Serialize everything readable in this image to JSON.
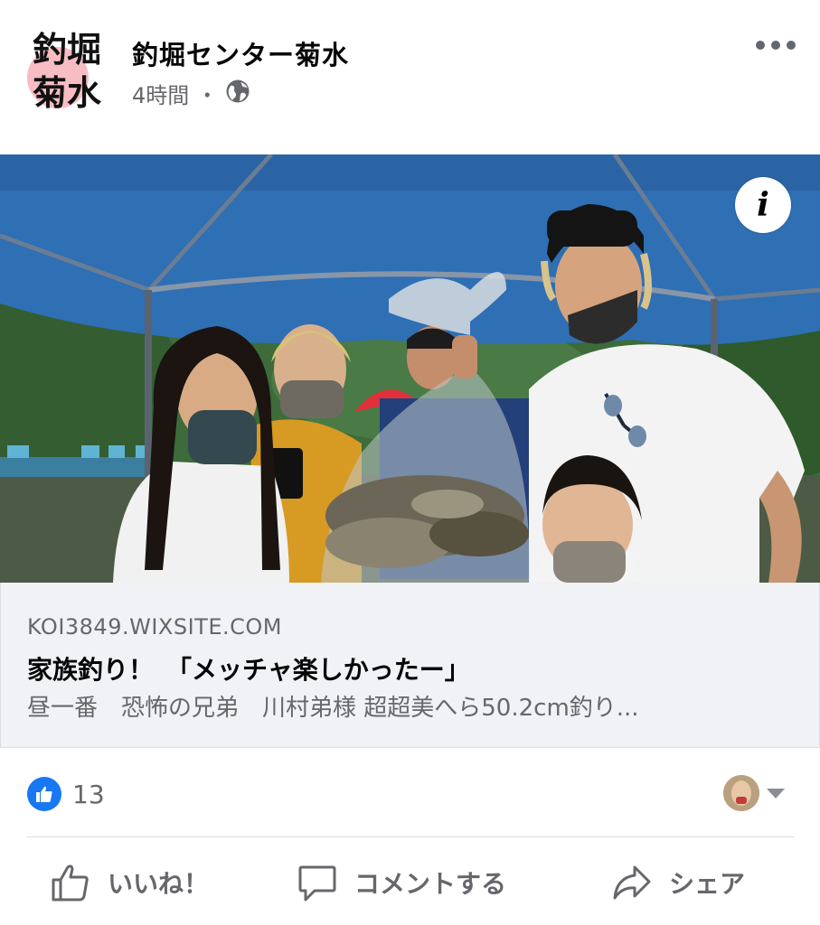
{
  "post": {
    "page_name": "釣堀センター菊水",
    "time": "4時間",
    "separator": "・",
    "avatar_text_line1": "釣堀",
    "avatar_text_line2": "菊水"
  },
  "link_preview": {
    "domain": "KOI3849.WIXSITE.COM",
    "title": "家族釣り！　「メッチャ楽しかったー」",
    "description": "昼一番　恐怖の兄弟　川村弟様 超超美へら50.2cm釣り..."
  },
  "reactions": {
    "like_count": "13"
  },
  "actions": {
    "like_label": "いいね！",
    "comment_label": "コメントする",
    "share_label": "シェア"
  },
  "icons": {
    "more": "more-icon",
    "globe": "globe-icon",
    "info": "info-icon",
    "like_reaction": "thumbs-up-icon",
    "caret": "caret-down-icon"
  },
  "colors": {
    "accent": "#1877f2",
    "secondary_text": "#65676b",
    "link_bg": "#f0f2f5",
    "tent": "#2f6fb4"
  }
}
